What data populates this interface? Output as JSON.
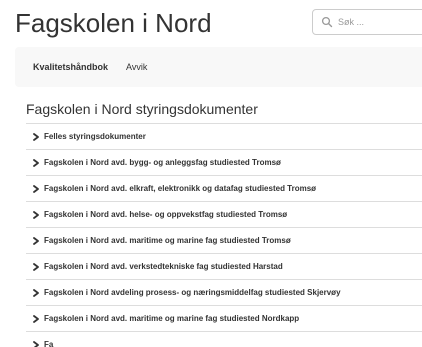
{
  "header": {
    "site_title": "Fagskolen i Nord",
    "search_placeholder": "Søk ..."
  },
  "nav": {
    "items": [
      {
        "label": "Kvalitetshåndbok"
      },
      {
        "label": "Avvik"
      }
    ]
  },
  "main": {
    "section_title": "Fagskolen i Nord styringsdokumenter",
    "items": [
      {
        "label": "Felles styringsdokumenter"
      },
      {
        "label": "Fagskolen i Nord avd. bygg- og anleggsfag studiested Tromsø"
      },
      {
        "label": "Fagskolen i Nord avd. elkraft, elektronikk og datafag studiested Tromsø"
      },
      {
        "label": "Fagskolen i Nord avd. helse- og oppvekstfag studiested Tromsø"
      },
      {
        "label": "Fagskolen i Nord avd. maritime og marine fag studiested Tromsø"
      },
      {
        "label": "Fagskolen i Nord avd. verkstedtekniske fag studiested Harstad"
      },
      {
        "label": "Fagskolen i Nord avdeling prosess- og næringsmiddelfag studiested Skjervøy"
      },
      {
        "label": "Fagskolen i Nord avd. maritime og marine fag studiested Nordkapp"
      },
      {
        "label": "Fa"
      }
    ]
  },
  "icons": {
    "search": "search-icon",
    "chevron": "chevron-right-icon"
  },
  "colors": {
    "text": "#333333",
    "navbar_bg": "#f8f8f8",
    "border": "#dddddd",
    "placeholder": "#999999"
  }
}
